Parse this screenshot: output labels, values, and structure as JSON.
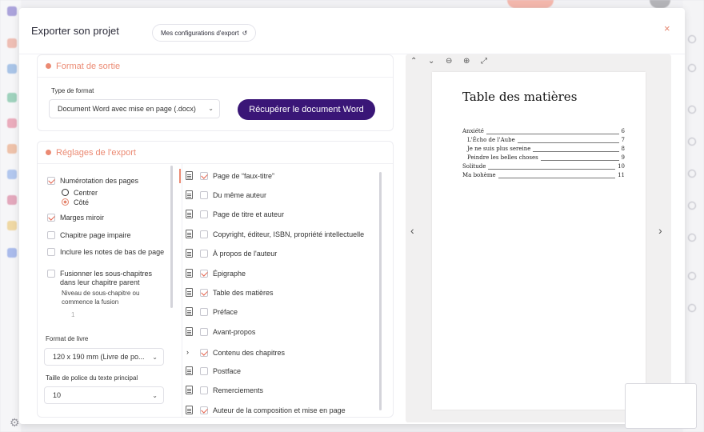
{
  "modal": {
    "title": "Exporter son projet",
    "config_button": "Mes configurations d'export",
    "close": "×"
  },
  "format_section": {
    "title": "Format de sortie",
    "type_label": "Type de format",
    "type_value": "Document Word avec mise en page (.docx)",
    "download_button": "Récupérer le document Word"
  },
  "settings_section": {
    "title": "Réglages de l'export",
    "page_numbering": "Numérotation des pages",
    "pos_center": "Centrer",
    "pos_side": "Côté",
    "mirror_margins": "Marges miroir",
    "odd_chapter": "Chapitre page impaire",
    "footnotes": "Inclure les notes de bas de page",
    "merge_subchapters": "Fusionner les sous-chapitres dans leur chapitre parent",
    "merge_hint": "Niveau de sous-chapitre ou commence la fusion",
    "merge_level": "1",
    "book_format_label": "Format de livre",
    "book_format_value": "120 x 190 mm (Livre de po...",
    "font_size_label": "Taille de police du texte principal",
    "font_size_value": "10"
  },
  "sections_list": [
    {
      "label": "Page de “faux-titre”",
      "checked": true,
      "icon": "doc"
    },
    {
      "label": "Du même auteur",
      "checked": false,
      "icon": "doc"
    },
    {
      "label": "Page de titre et auteur",
      "checked": false,
      "icon": "doc"
    },
    {
      "label": "Copyright, éditeur, ISBN, propriété intellectuelle",
      "checked": false,
      "icon": "doc"
    },
    {
      "label": "À propos de l'auteur",
      "checked": false,
      "icon": "doc"
    },
    {
      "label": "Épigraphe",
      "checked": true,
      "icon": "doc"
    },
    {
      "label": "Table des matières",
      "checked": true,
      "icon": "doc"
    },
    {
      "label": "Préface",
      "checked": false,
      "icon": "doc"
    },
    {
      "label": "Avant-propos",
      "checked": false,
      "icon": "doc"
    },
    {
      "label": "Contenu des chapitres",
      "checked": true,
      "icon": "chevron"
    },
    {
      "label": "Postface",
      "checked": false,
      "icon": "doc"
    },
    {
      "label": "Remerciements",
      "checked": false,
      "icon": "doc"
    },
    {
      "label": "Auteur de la composition et mise en page",
      "checked": true,
      "icon": "doc"
    }
  ],
  "preview": {
    "toc_title": "Table des matières",
    "entries": [
      {
        "text": "Anxiété",
        "page": "6",
        "indent": 0
      },
      {
        "text": "L'Écho de l'Aube",
        "page": "7",
        "indent": 1
      },
      {
        "text": "Je ne suis plus sereine",
        "page": "8",
        "indent": 1
      },
      {
        "text": "Peindre les belles choses",
        "page": "9",
        "indent": 1
      },
      {
        "text": "Solitude",
        "page": "10",
        "indent": 0
      },
      {
        "text": "Ma bohème",
        "page": "11",
        "indent": 0
      }
    ]
  },
  "colors": {
    "accent": "#eb8a73",
    "primary": "#3a1677"
  }
}
